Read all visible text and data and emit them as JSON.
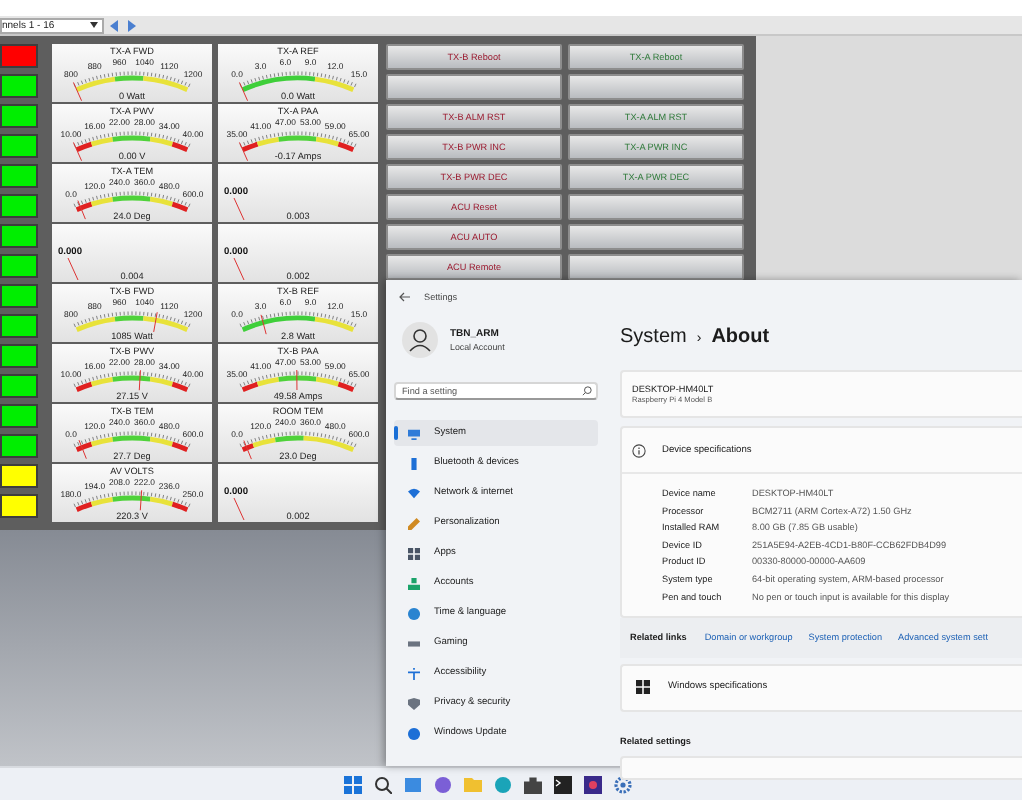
{
  "toolbar": {
    "channel_select": "nnels 1 - 16"
  },
  "indicators": [
    {
      "color": "#ff0000"
    },
    {
      "color": "#00ee00"
    },
    {
      "color": "#00ee00"
    },
    {
      "color": "#00ee00"
    },
    {
      "color": "#00ee00"
    },
    {
      "color": "#00ee00"
    },
    {
      "color": "#00ee00"
    },
    {
      "color": "#00ee00"
    },
    {
      "color": "#00ee00"
    },
    {
      "color": "#00ee00"
    },
    {
      "color": "#00ee00"
    },
    {
      "color": "#00ee00"
    },
    {
      "color": "#00ee00"
    },
    {
      "color": "#00ee00"
    },
    {
      "color": "#ffff00"
    },
    {
      "color": "#ffff00"
    }
  ],
  "meters": [
    {
      "kind": "fwd",
      "title": "TX-A FWD",
      "ticks": [
        "800",
        "880",
        "960",
        "1040",
        "1120",
        "1200"
      ],
      "reading": "0 Watt",
      "level": 0.0
    },
    {
      "kind": "ref",
      "title": "TX-A REF",
      "ticks": [
        "0.0",
        "3.0",
        "6.0",
        "9.0",
        "12.0",
        "15.0"
      ],
      "reading": "0.0 Watt",
      "level": 0.0
    },
    {
      "kind": "band",
      "title": "TX-A PWV",
      "ticks": [
        "10.00",
        "16.00",
        "22.00",
        "28.00",
        "34.00",
        "40.00"
      ],
      "reading": "0.00 V",
      "level": 0.0
    },
    {
      "kind": "band",
      "title": "TX-A PAA",
      "ticks": [
        "35.00",
        "41.00",
        "47.00",
        "53.00",
        "59.00",
        "65.00"
      ],
      "reading": "-0.17 Amps",
      "level": 0.0
    },
    {
      "kind": "band",
      "title": "TX-A TEM",
      "ticks": [
        "0.0",
        "120.0",
        "240.0",
        "360.0",
        "480.0",
        "600.0"
      ],
      "reading": "24.0 Deg",
      "level": 0.04
    },
    {
      "kind": "blank",
      "zero": "0.000",
      "reading": "0.003"
    },
    {
      "kind": "blank",
      "zero": "0.000",
      "reading": "0.004"
    },
    {
      "kind": "blank",
      "zero": "0.000",
      "reading": "0.002"
    },
    {
      "kind": "fwd",
      "title": "TX-B FWD",
      "ticks": [
        "800",
        "880",
        "960",
        "1040",
        "1120",
        "1200"
      ],
      "reading": "1085 Watt",
      "level": 0.71
    },
    {
      "kind": "ref",
      "title": "TX-B REF",
      "ticks": [
        "0.0",
        "3.0",
        "6.0",
        "9.0",
        "12.0",
        "15.0"
      ],
      "reading": "2.8 Watt",
      "level": 0.19
    },
    {
      "kind": "band",
      "title": "TX-B PWV",
      "ticks": [
        "10.00",
        "16.00",
        "22.00",
        "28.00",
        "34.00",
        "40.00"
      ],
      "reading": "27.15 V",
      "level": 0.57
    },
    {
      "kind": "band",
      "title": "TX-B PAA",
      "ticks": [
        "35.00",
        "41.00",
        "47.00",
        "53.00",
        "59.00",
        "65.00"
      ],
      "reading": "49.58 Amps",
      "level": 0.49
    },
    {
      "kind": "band",
      "title": "TX-B TEM",
      "ticks": [
        "0.0",
        "120.0",
        "240.0",
        "360.0",
        "480.0",
        "600.0"
      ],
      "reading": "27.7 Deg",
      "level": 0.05
    },
    {
      "kind": "room",
      "title": "ROOM TEM",
      "ticks": [
        "0.0",
        "120.0",
        "240.0",
        "360.0",
        "480.0",
        "600.0"
      ],
      "reading": "23.0 Deg",
      "level": 0.04
    },
    {
      "kind": "band",
      "title": "AV VOLTS",
      "ticks": [
        "180.0",
        "194.0",
        "208.0",
        "222.0",
        "236.0",
        "250.0"
      ],
      "reading": "220.3 V",
      "level": 0.58
    },
    {
      "kind": "blank",
      "zero": "0.000",
      "reading": "0.002"
    }
  ],
  "buttons": [
    {
      "kind": "command",
      "label": "TX-B Reboot"
    },
    {
      "kind": "command",
      "label": "TX-A Reboot"
    },
    {
      "kind": "empty"
    },
    {
      "kind": "empty"
    },
    {
      "kind": "command",
      "label": "TX-B ALM RST"
    },
    {
      "kind": "command",
      "label": "TX-A ALM RST"
    },
    {
      "kind": "command",
      "label": "TX-B PWR INC"
    },
    {
      "kind": "command",
      "label": "TX-A PWR INC"
    },
    {
      "kind": "command",
      "label": "TX-B PWR DEC"
    },
    {
      "kind": "command",
      "label": "TX-A PWR DEC"
    },
    {
      "kind": "command",
      "label": "ACU Reset"
    },
    {
      "kind": "empty"
    },
    {
      "kind": "command",
      "label": "ACU AUTO"
    },
    {
      "kind": "empty"
    },
    {
      "kind": "command",
      "label": "ACU Remote"
    },
    {
      "kind": "empty"
    }
  ],
  "settings": {
    "title": "Settings",
    "user": {
      "name": "TBN_ARM",
      "account": "Local Account"
    },
    "search": {
      "placeholder": "Find a setting"
    },
    "nav": [
      {
        "label": "System",
        "selected": true
      },
      {
        "label": "Bluetooth & devices",
        "selected": false
      },
      {
        "label": "Network & internet",
        "selected": false
      },
      {
        "label": "Personalization",
        "selected": false
      },
      {
        "label": "Apps",
        "selected": false
      },
      {
        "label": "Accounts",
        "selected": false
      },
      {
        "label": "Time & language",
        "selected": false
      },
      {
        "label": "Gaming",
        "selected": false
      },
      {
        "label": "Accessibility",
        "selected": false
      },
      {
        "label": "Privacy & security",
        "selected": false
      },
      {
        "label": "Windows Update",
        "selected": false
      }
    ],
    "breadcrumb": {
      "parent": "System",
      "separator": "›",
      "current": "About"
    },
    "device": {
      "name": "DESKTOP-HM40LT",
      "model": "Raspberry Pi 4 Model B"
    },
    "specs": {
      "title": "Device specifications",
      "rows": [
        {
          "label": "Device name",
          "value": "DESKTOP-HM40LT"
        },
        {
          "label": "Processor",
          "value": "BCM2711 (ARM Cortex-A72)   1.50 GHz"
        },
        {
          "label": "Installed RAM",
          "value": "8.00 GB (7.85 GB usable)"
        },
        {
          "label": "Device ID",
          "value": "251A5E94-A2EB-4CD1-B80F-CCB62FDB4D99"
        },
        {
          "label": "Product ID",
          "value": "00330-80000-00000-AA609"
        },
        {
          "label": "System type",
          "value": "64-bit operating system, ARM-based processor"
        },
        {
          "label": "Pen and touch",
          "value": "No pen or touch input is available for this display"
        }
      ]
    },
    "related_links": {
      "title": "Related links",
      "links": [
        "Domain or workgroup",
        "System protection",
        "Advanced system sett"
      ]
    },
    "windows_specs": {
      "title": "Windows specifications"
    },
    "related_settings": {
      "title": "Related settings"
    }
  }
}
